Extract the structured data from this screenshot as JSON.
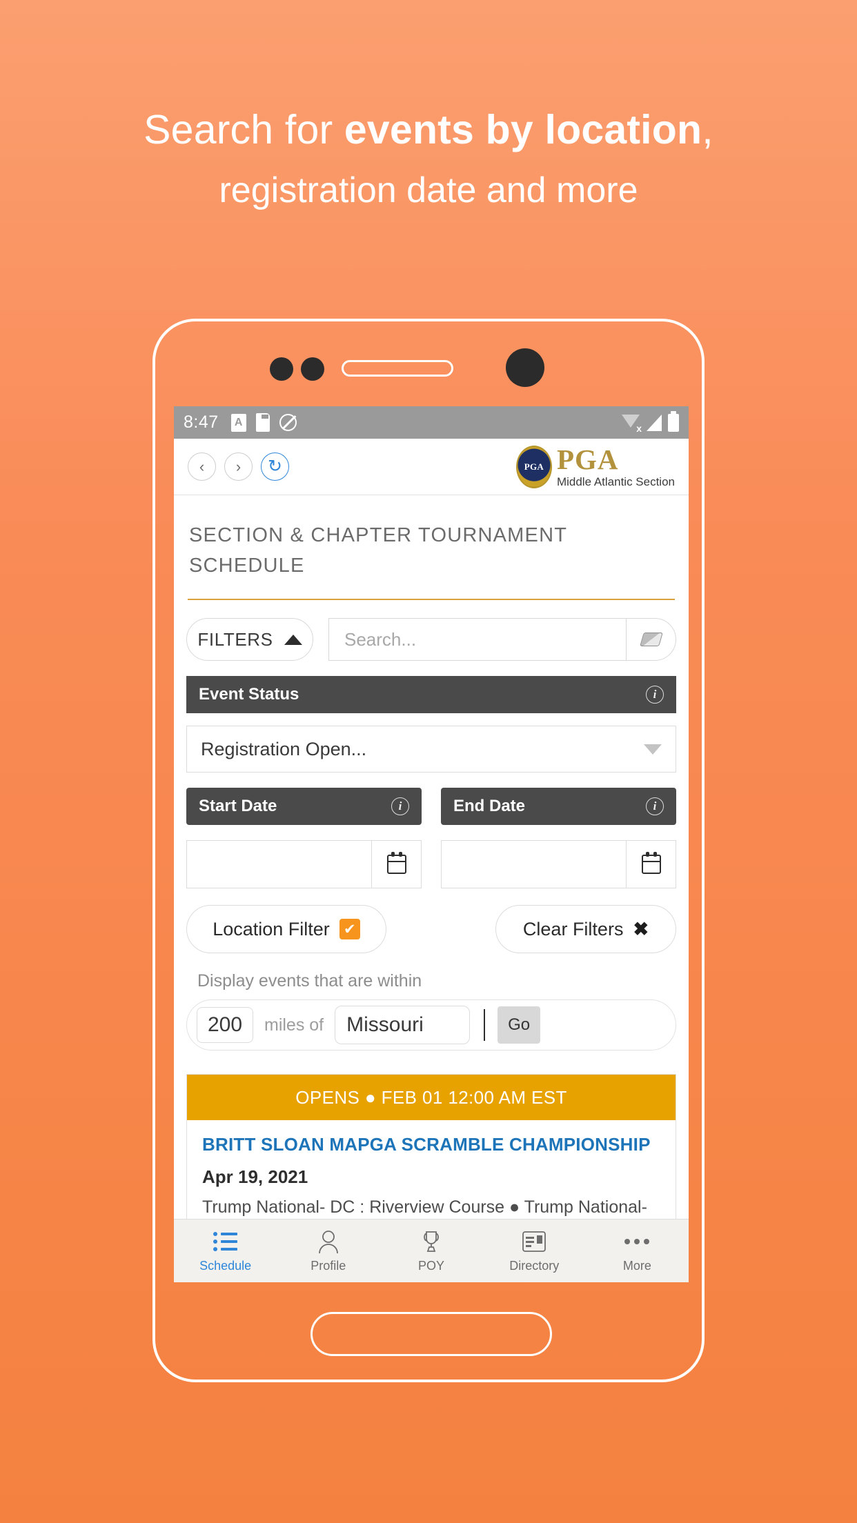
{
  "promo": {
    "line1_prefix": "Search for ",
    "line1_bold": "events by location",
    "line1_suffix": ",",
    "line2": "registration date and more"
  },
  "statusbar": {
    "time": "8:47",
    "icons_left": [
      "keyboard-A-icon",
      "sd-card-icon",
      "do-not-disturb-icon"
    ],
    "icons_right": [
      "wifi-off-icon",
      "signal-icon",
      "battery-icon"
    ]
  },
  "browser": {
    "back_label": "‹",
    "forward_label": "›",
    "reload_label": "↻",
    "logo_seal_text": "PGA",
    "logo_title": "PGA",
    "logo_subtitle": "Middle Atlantic Section"
  },
  "page": {
    "title": "SECTION & CHAPTER TOURNAMENT SCHEDULE"
  },
  "toolbar": {
    "filters_label": "FILTERS",
    "search_placeholder": "Search...",
    "search_value": "",
    "eraser_icon": "eraser-icon"
  },
  "filters": {
    "event_status": {
      "header": "Event Status",
      "selected": "Registration Open...",
      "info_label": "i"
    },
    "start_date": {
      "header": "Start Date",
      "value": "",
      "info_label": "i",
      "calendar_icon": "calendar-icon"
    },
    "end_date": {
      "header": "End Date",
      "value": "",
      "info_label": "i",
      "calendar_icon": "calendar-icon"
    },
    "location_filter_label": "Location Filter",
    "location_filter_checked": "✔",
    "clear_filters_label": "Clear Filters",
    "clear_filters_icon": "✖"
  },
  "distance": {
    "within_label": "Display events that are within",
    "miles_value": "200",
    "miles_of_label": "miles of",
    "location_value": "Missouri",
    "go_label": "Go"
  },
  "events": [
    {
      "banner": "OPENS ● FEB 01 12:00 AM EST",
      "name": "BRITT SLOAN MAPGA SCRAMBLE CHAMPIONSHIP",
      "date": "Apr 19, 2021",
      "venue": "Trump National- DC : Riverview Course ● Trump National-"
    }
  ],
  "bottom_nav": [
    {
      "label": "Schedule",
      "icon": "list-icon",
      "active": true
    },
    {
      "label": "Profile",
      "icon": "person-icon",
      "active": false
    },
    {
      "label": "POY",
      "icon": "trophy-icon",
      "active": false
    },
    {
      "label": "Directory",
      "icon": "id-card-icon",
      "active": false
    },
    {
      "label": "More",
      "icon": "ellipsis-icon",
      "active": false
    }
  ],
  "colors": {
    "background_top": "#fb9f70",
    "background_bottom": "#f4813f",
    "accent_orange": "#f7941e",
    "banner_gold": "#e8a200",
    "link_blue": "#1d74b8",
    "header_dark": "#4a4a4a",
    "logo_gold": "#b2923c"
  }
}
